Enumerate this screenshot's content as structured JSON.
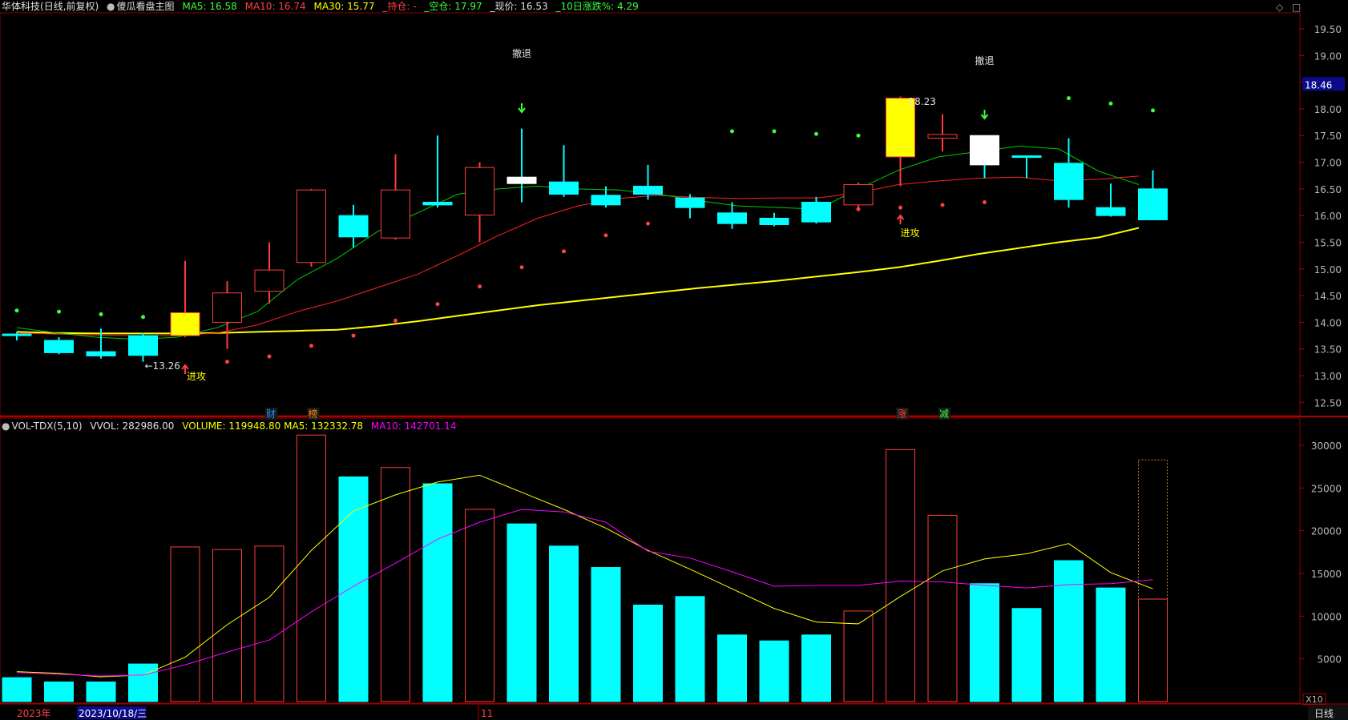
{
  "header": {
    "stock": "华体科技",
    "mode": "(日线,前复权)",
    "indicator_name": "傻瓜看盘主图",
    "ma5": "MA5: 16.58",
    "ma10": "MA10: 16.74",
    "ma30": "MA30: 15.77",
    "hold": "_持仓: -",
    "short": "_空仓: 17.97",
    "price": "_现价: 16.53",
    "chg10": "_10日涨跌%: 4.29",
    "ctrl_diamond": "◇",
    "ctrl_box": "□"
  },
  "vol_header": {
    "name": "VOL-TDX(5,10)",
    "vvol": "VVOL: 282986.00",
    "volume": "VOLUME: 119948.80",
    "ma5": "MA5: 132332.78",
    "ma10": "MA10: 142701.14"
  },
  "colors": {
    "up": "#ff3c3c",
    "down": "#00ffff",
    "ma5": "#00cc00",
    "ma10": "#ff2020",
    "ma30": "#ffff00",
    "text_green": "#3cff3c",
    "text_red": "#ff4040",
    "text_yellow": "#ffff00"
  },
  "price_axis": {
    "ticks": [
      "19.50",
      "19.00",
      "18.50",
      "18.00",
      "17.50",
      "17.00",
      "16.50",
      "16.00",
      "15.50",
      "15.00",
      "14.50",
      "14.00",
      "13.50",
      "13.00",
      "12.50"
    ],
    "current": "18.46"
  },
  "vol_axis": {
    "ticks": [
      "30000",
      "25000",
      "20000",
      "15000",
      "10000",
      "5000"
    ],
    "unit": "X10"
  },
  "date_axis": {
    "year": "2023年",
    "cursor_date": "2023/10/18/三",
    "month": "11",
    "period": "日线"
  },
  "annotations": {
    "retreat": "撤退",
    "attack": "进攻",
    "low_label": "←13.26",
    "high_label": "18.23",
    "events": [
      "财",
      "榜",
      "涨",
      "减"
    ]
  },
  "chart_data": {
    "type": "candlestick",
    "candles": [
      {
        "o": 13.78,
        "h": 13.82,
        "l": 13.66,
        "c": 13.77
      },
      {
        "o": 13.66,
        "h": 13.72,
        "l": 13.4,
        "c": 13.43
      },
      {
        "o": 13.45,
        "h": 13.88,
        "l": 13.32,
        "c": 13.37
      },
      {
        "o": 13.75,
        "h": 13.8,
        "l": 13.26,
        "c": 13.38
      },
      {
        "o": 13.75,
        "h": 15.15,
        "l": 13.72,
        "c": 14.18
      },
      {
        "o": 14.0,
        "h": 14.77,
        "l": 13.5,
        "c": 14.55
      },
      {
        "o": 14.58,
        "h": 15.5,
        "l": 14.35,
        "c": 14.98
      },
      {
        "o": 15.12,
        "h": 16.5,
        "l": 15.04,
        "c": 16.48
      },
      {
        "o": 16.0,
        "h": 16.2,
        "l": 15.4,
        "c": 15.6
      },
      {
        "o": 15.58,
        "h": 17.15,
        "l": 15.55,
        "c": 16.48
      },
      {
        "o": 16.25,
        "h": 17.5,
        "l": 16.15,
        "c": 16.2
      },
      {
        "o": 16.01,
        "h": 17.0,
        "l": 15.5,
        "c": 16.9
      },
      {
        "o": 16.72,
        "h": 17.63,
        "l": 16.25,
        "c": 16.6
      },
      {
        "o": 16.63,
        "h": 17.32,
        "l": 16.35,
        "c": 16.4
      },
      {
        "o": 16.38,
        "h": 16.55,
        "l": 16.15,
        "c": 16.2
      },
      {
        "o": 16.55,
        "h": 16.95,
        "l": 16.3,
        "c": 16.4
      },
      {
        "o": 16.33,
        "h": 16.4,
        "l": 15.95,
        "c": 16.15
      },
      {
        "o": 16.05,
        "h": 16.25,
        "l": 15.75,
        "c": 15.85
      },
      {
        "o": 15.95,
        "h": 16.05,
        "l": 15.8,
        "c": 15.83
      },
      {
        "o": 16.25,
        "h": 16.35,
        "l": 15.85,
        "c": 15.88
      },
      {
        "o": 16.2,
        "h": 16.62,
        "l": 16.15,
        "c": 16.58
      },
      {
        "o": 17.1,
        "h": 18.23,
        "l": 16.55,
        "c": 18.2
      },
      {
        "o": 17.45,
        "h": 17.9,
        "l": 17.2,
        "c": 17.52
      },
      {
        "o": 17.5,
        "h": 17.5,
        "l": 16.7,
        "c": 16.95
      },
      {
        "o": 17.12,
        "h": 17.12,
        "l": 16.7,
        "c": 17.1
      },
      {
        "o": 16.98,
        "h": 17.45,
        "l": 16.15,
        "c": 16.3
      },
      {
        "o": 16.15,
        "h": 16.6,
        "l": 15.98,
        "c": 16.0
      },
      {
        "o": 16.5,
        "h": 16.85,
        "l": 15.92,
        "c": 15.92
      }
    ],
    "ma5": [
      13.9,
      13.8,
      13.72,
      13.68,
      13.72,
      13.9,
      14.2,
      14.8,
      15.2,
      15.7,
      16.05,
      16.4,
      16.5,
      16.55,
      16.5,
      16.48,
      16.4,
      16.28,
      16.18,
      16.15,
      16.12,
      16.5,
      16.85,
      17.1,
      17.2,
      17.3,
      17.25,
      16.83,
      16.58
    ],
    "ma10": [
      13.8,
      13.78,
      13.76,
      13.75,
      13.75,
      13.8,
      13.95,
      14.2,
      14.4,
      14.65,
      14.9,
      15.25,
      15.62,
      15.95,
      16.18,
      16.32,
      16.38,
      16.34,
      16.32,
      16.33,
      16.33,
      16.43,
      16.58,
      16.65,
      16.7,
      16.72,
      16.65,
      16.68,
      16.74
    ],
    "ma30": [
      13.82,
      13.8,
      13.79,
      13.79,
      13.79,
      13.8,
      13.82,
      13.84,
      13.86,
      13.93,
      14.02,
      14.12,
      14.22,
      14.32,
      14.4,
      14.48,
      14.56,
      14.64,
      14.71,
      14.78,
      14.86,
      14.94,
      15.03,
      15.15,
      15.28,
      15.39,
      15.5,
      15.59,
      15.77
    ],
    "sell_dots": [
      14.22,
      14.2,
      14.15,
      14.1,
      null,
      null,
      null,
      null,
      null,
      null,
      null,
      null,
      null,
      null,
      null,
      null,
      null,
      17.58,
      17.58,
      17.53,
      17.5,
      null,
      null,
      null,
      null,
      18.2,
      18.1,
      17.97
    ],
    "buy_dots": [
      null,
      null,
      null,
      null,
      null,
      13.26,
      13.36,
      13.56,
      13.75,
      14.03,
      14.34,
      14.67,
      15.03,
      15.33,
      15.63,
      15.85,
      null,
      null,
      null,
      null,
      16.12,
      16.15,
      16.2,
      16.25,
      null,
      null,
      null,
      null
    ],
    "volume": [
      2800,
      2300,
      2300,
      4400,
      18100,
      17800,
      18200,
      31200,
      26300,
      27400,
      25500,
      22500,
      20800,
      18200,
      15700,
      11300,
      12300,
      7800,
      7100,
      7800,
      10600,
      29500,
      21800,
      13800,
      10900,
      16500,
      13300,
      11995
    ],
    "vol_ma5": [
      3500,
      3300,
      2900,
      3100,
      5200,
      9000,
      12200,
      17700,
      22300,
      24200,
      25700,
      26500,
      24500,
      22500,
      20300,
      17700,
      15500,
      13200,
      10900,
      9300,
      9100,
      12300,
      15300,
      16700,
      17300,
      18500,
      15100,
      13200
    ],
    "vol_ma10": [
      3400,
      3200,
      3000,
      3100,
      4300,
      5800,
      7200,
      10500,
      13500,
      16200,
      19000,
      21000,
      22500,
      22200,
      21000,
      17600,
      16800,
      15200,
      13500,
      13600,
      13600,
      14100,
      14000,
      13600,
      13300,
      13700,
      13800,
      14270
    ],
    "price_range": [
      12.25,
      19.8
    ],
    "volume_range": [
      0,
      31500
    ],
    "volume_unit": "X10"
  }
}
